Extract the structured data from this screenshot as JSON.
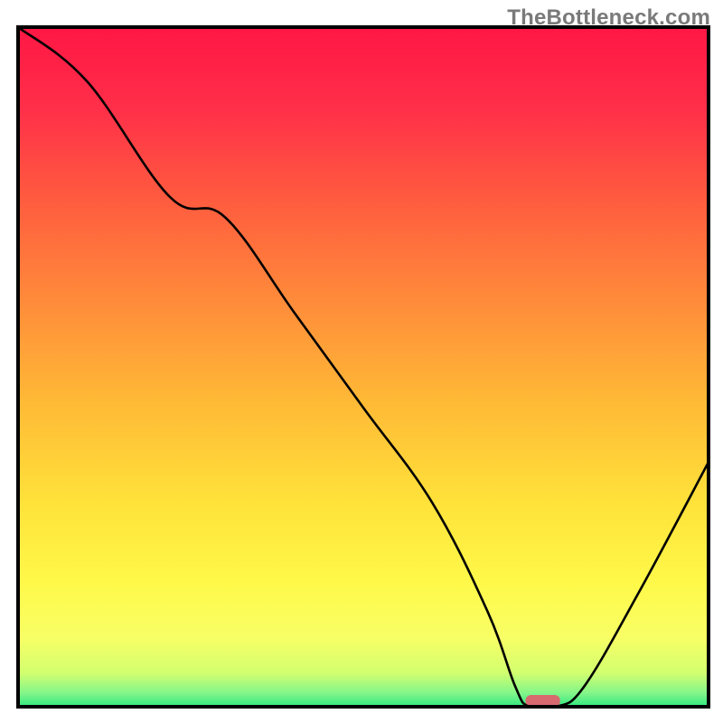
{
  "watermark": "TheBottleneck.com",
  "chart_data": {
    "type": "line",
    "title": "",
    "xlabel": "",
    "ylabel": "",
    "xlim": [
      0,
      100
    ],
    "ylim": [
      0,
      100
    ],
    "grid": false,
    "legend": false,
    "annotations": [],
    "background_gradient": {
      "stops": [
        {
          "offset": 0.0,
          "color": "#ff1744"
        },
        {
          "offset": 0.12,
          "color": "#ff2f49"
        },
        {
          "offset": 0.25,
          "color": "#ff5a3f"
        },
        {
          "offset": 0.4,
          "color": "#ff8a3a"
        },
        {
          "offset": 0.55,
          "color": "#ffb936"
        },
        {
          "offset": 0.7,
          "color": "#ffe23a"
        },
        {
          "offset": 0.82,
          "color": "#fff94a"
        },
        {
          "offset": 0.9,
          "color": "#f7ff66"
        },
        {
          "offset": 0.95,
          "color": "#d2ff6f"
        },
        {
          "offset": 0.98,
          "color": "#83f58a"
        },
        {
          "offset": 1.0,
          "color": "#2fe981"
        }
      ]
    },
    "series": [
      {
        "name": "bottleneck-curve",
        "x": [
          0,
          10,
          22,
          30,
          40,
          50,
          60,
          68,
          72,
          74,
          78,
          82,
          90,
          100
        ],
        "y": [
          100,
          92,
          75,
          72,
          58,
          44,
          30,
          14,
          3,
          0,
          0,
          3,
          17,
          36
        ]
      }
    ],
    "marker": {
      "name": "optimal-region",
      "x_center": 76,
      "x_width": 5,
      "y": 0,
      "color": "#d86a6f"
    },
    "frame": {
      "color": "#000000",
      "width": 4
    },
    "curve_style": {
      "color": "#000000",
      "width": 2.6
    }
  }
}
